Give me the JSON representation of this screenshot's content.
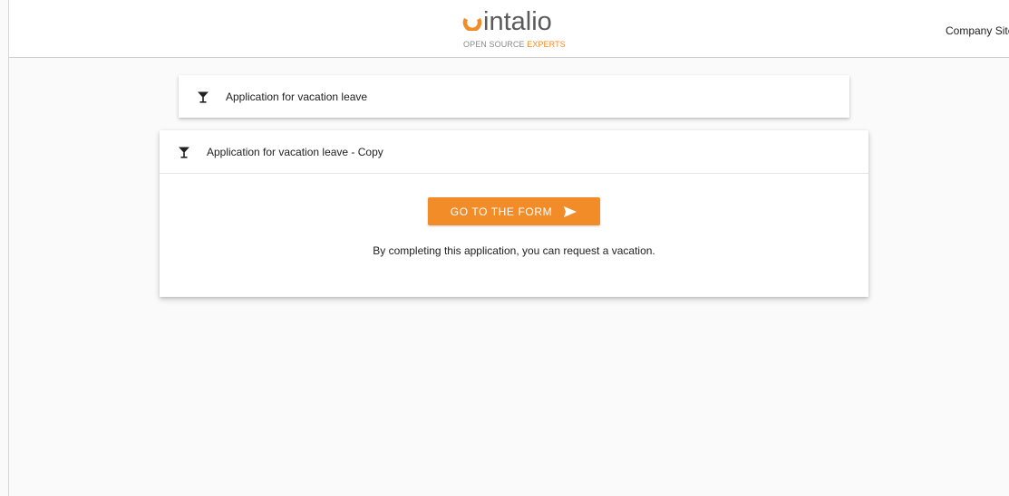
{
  "header": {
    "logo": {
      "word": "intalio",
      "tag_plain": "OPEN SOURCE",
      "tag_accent": "EXPERTS",
      "icon": "intalio-ring-logo"
    },
    "company_link": "Company Site"
  },
  "cards": [
    {
      "title": "Application for vacation leave",
      "icon": "cocktail-glass-icon",
      "expanded": false
    },
    {
      "title": "Application for vacation leave - Copy",
      "icon": "cocktail-glass-icon",
      "expanded": true,
      "button_label": "GO TO THE FORM",
      "button_icon": "send-arrow-icon",
      "description": "By completing this application, you can request a vacation."
    }
  ],
  "colors": {
    "accent": "#f28c28",
    "logo_text": "#5a5a5a",
    "background": "#fafafa"
  }
}
